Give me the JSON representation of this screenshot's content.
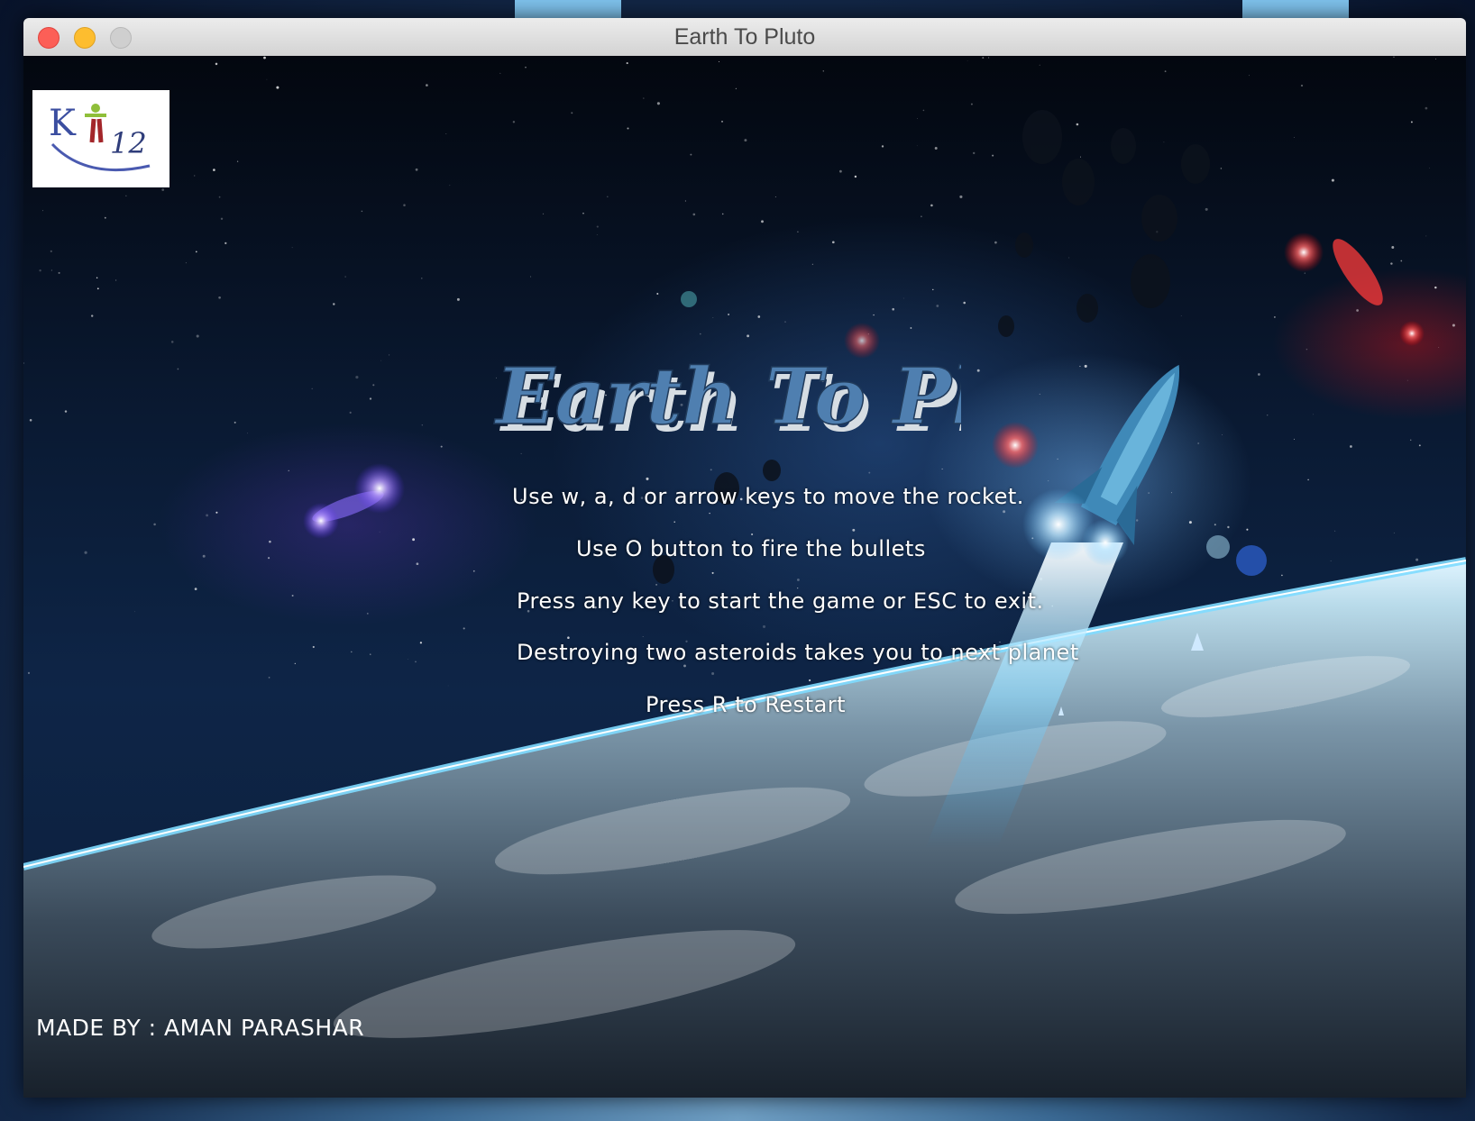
{
  "window": {
    "title": "Earth To Pluto"
  },
  "game": {
    "logo_text": "K12",
    "title": "Earth To Pluto",
    "instructions": [
      "Use w, a, d or arrow keys to move the rocket.",
      "Use O button to fire the bullets",
      "Press any key to start the game or ESC to exit.",
      "Destroying two asteroids takes you to next planet",
      "Press R to Restart"
    ],
    "credit": "MADE BY : AMAN PARASHAR"
  },
  "colors": {
    "title_fill": "#4f7fb0",
    "title_shadow": "#c9d4dc",
    "text": "#ffffff",
    "planet_glow": "#6fd0ff"
  },
  "icons": [
    "close-window-icon",
    "minimize-window-icon",
    "zoom-window-icon",
    "rocket-icon",
    "k12-logo-icon"
  ]
}
